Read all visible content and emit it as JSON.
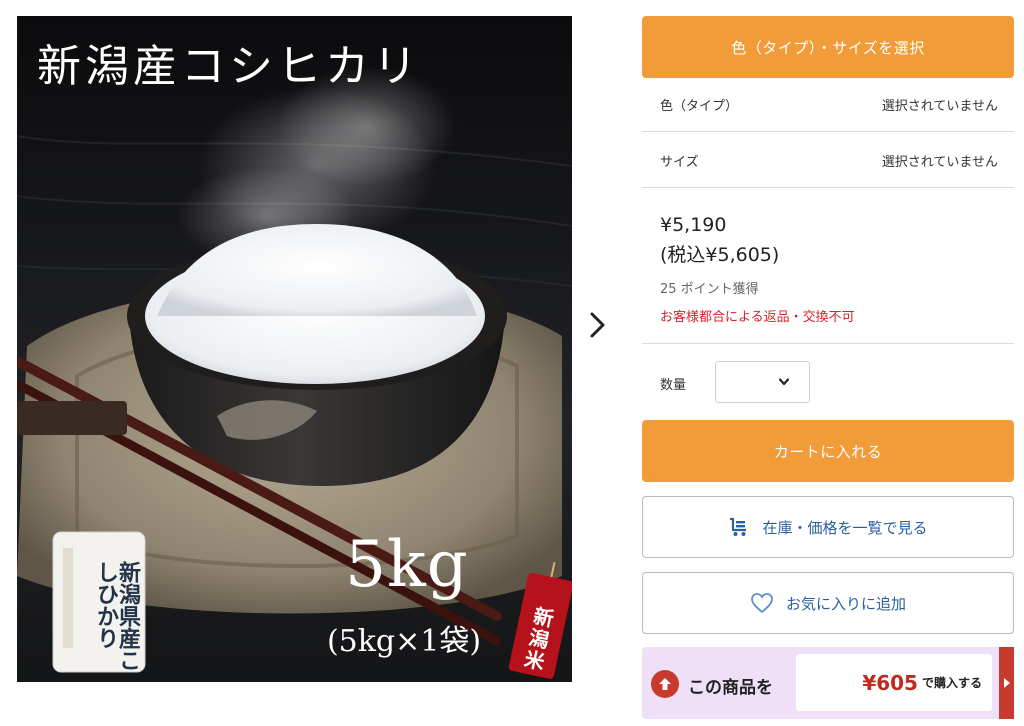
{
  "product_image": {
    "title": "新潟産コシヒカリ",
    "weight": "5kg",
    "subweight": "(5kg×1袋)",
    "tag_text": "新潟米",
    "bag_text": "新潟県産こしひかり"
  },
  "carousel": {
    "next_icon": "chevron-right-icon"
  },
  "panel": {
    "select_button_label": "色（タイプ）・サイズを選択",
    "options": [
      {
        "label": "色（タイプ）",
        "value": "選択されていません"
      },
      {
        "label": "サイズ",
        "value": "選択されていません"
      }
    ],
    "price": "¥5,190",
    "price_tax_included": "(税込¥5,605)",
    "points": "25 ポイント獲得",
    "return_notice": "お客様都合による返品・交換不可",
    "quantity_label": "数量",
    "quantity_value": "",
    "add_to_cart_label": "カートに入れる",
    "stock_price_label": "在庫・価格を一覧で見る",
    "favorite_label": "お気に入りに追加",
    "promo": {
      "label": "この商品を",
      "price": "¥605",
      "suffix": "で購入する"
    }
  },
  "colors": {
    "accent_orange": "#f19c38",
    "link_blue": "#2b5fa0",
    "warning_red": "#d8222a",
    "promo_bg": "#efe0f8",
    "promo_red": "#c93a2e"
  }
}
